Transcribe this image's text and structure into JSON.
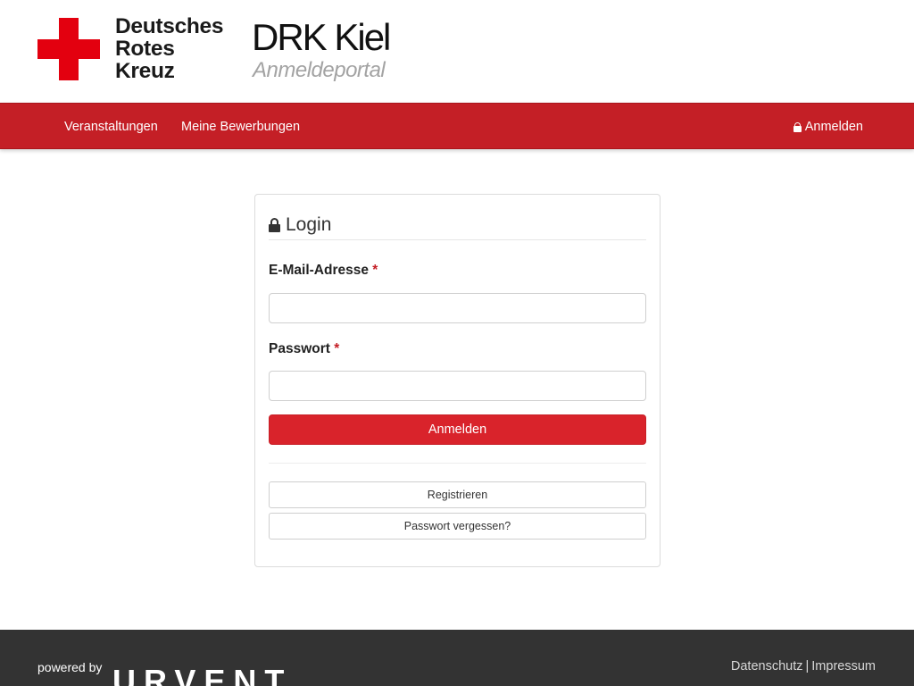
{
  "header": {
    "org_lines": [
      "Deutsches",
      "Rotes",
      "Kreuz"
    ],
    "site_title": "DRK Kiel",
    "site_subtitle": "Anmeldeportal",
    "brand_color": "#e3000f"
  },
  "nav": {
    "items": [
      {
        "label": "Veranstaltungen"
      },
      {
        "label": "Meine Bewerbungen"
      }
    ],
    "login_label": "Anmelden",
    "login_icon": "lock-icon",
    "background_color": "#c41f26"
  },
  "login": {
    "title": "Login",
    "title_icon": "lock-icon",
    "email_label": "E-Mail-Adresse",
    "email_value": "",
    "password_label": "Passwort",
    "password_value": "",
    "required_marker": "*",
    "submit_label": "Anmelden",
    "register_label": "Registrieren",
    "forgot_label": "Passwort vergessen?",
    "primary_color": "#d9232b"
  },
  "footer": {
    "powered_by": "powered by",
    "brand": "URVENT",
    "links": [
      "Datenschutz",
      "Impressum"
    ],
    "separator": "|",
    "background_color": "#333333"
  }
}
